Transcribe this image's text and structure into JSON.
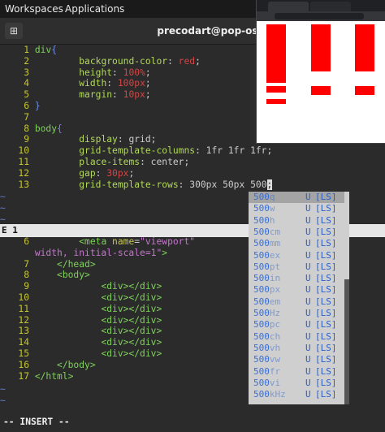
{
  "topbar": {
    "workspaces": "Workspaces",
    "applications": "Applications"
  },
  "window": {
    "title": "precodart@pop-os: ~"
  },
  "editor": {
    "css_lines": [
      {
        "n": "1",
        "parts": [
          [
            "kw",
            "div"
          ],
          [
            "br",
            "{"
          ]
        ]
      },
      {
        "n": "2",
        "parts": [
          [
            "t",
            "        "
          ],
          [
            "prop",
            "background-color"
          ],
          [
            "t",
            ": "
          ],
          [
            "val",
            "red"
          ],
          [
            "t",
            ";"
          ]
        ]
      },
      {
        "n": "3",
        "parts": [
          [
            "t",
            "        "
          ],
          [
            "prop",
            "height"
          ],
          [
            "t",
            ": "
          ],
          [
            "val",
            "100%"
          ],
          [
            "t",
            ";"
          ]
        ]
      },
      {
        "n": "4",
        "parts": [
          [
            "t",
            "        "
          ],
          [
            "prop",
            "width"
          ],
          [
            "t",
            ": "
          ],
          [
            "val",
            "100px"
          ],
          [
            "t",
            ";"
          ]
        ]
      },
      {
        "n": "5",
        "parts": [
          [
            "t",
            "        "
          ],
          [
            "prop",
            "margin"
          ],
          [
            "t",
            ": "
          ],
          [
            "val",
            "10px"
          ],
          [
            "t",
            ";"
          ]
        ]
      },
      {
        "n": "6",
        "parts": [
          [
            "br",
            "}"
          ]
        ]
      },
      {
        "n": "7",
        "parts": []
      },
      {
        "n": "8",
        "parts": [
          [
            "kw",
            "body"
          ],
          [
            "br",
            "{"
          ]
        ]
      },
      {
        "n": "9",
        "parts": [
          [
            "t",
            "        "
          ],
          [
            "prop",
            "display"
          ],
          [
            "t",
            ": "
          ],
          [
            "t",
            "grid"
          ],
          [
            "t",
            ";"
          ]
        ]
      },
      {
        "n": "10",
        "parts": [
          [
            "t",
            "        "
          ],
          [
            "prop",
            "grid-template-columns"
          ],
          [
            "t",
            ": 1fr 1fr 1fr;"
          ]
        ]
      },
      {
        "n": "11",
        "parts": [
          [
            "t",
            "        "
          ],
          [
            "prop",
            "place-items"
          ],
          [
            "t",
            ": "
          ],
          [
            "t",
            "center"
          ],
          [
            "t",
            ";"
          ]
        ]
      },
      {
        "n": "12",
        "parts": [
          [
            "t",
            "        "
          ],
          [
            "prop",
            "gap"
          ],
          [
            "t",
            ": "
          ],
          [
            "val",
            "30px"
          ],
          [
            "t",
            ";"
          ]
        ]
      },
      {
        "n": "13",
        "parts": [
          [
            "t",
            "        "
          ],
          [
            "prop",
            "grid-template-rows"
          ],
          [
            "t",
            ": 300px 50px 500"
          ],
          [
            "cursor",
            ";"
          ]
        ]
      }
    ],
    "tildes_top": [
      "~",
      "~",
      "~"
    ],
    "status_line": "E 1",
    "html_lines": [
      {
        "n": "6",
        "parts": [
          [
            "t",
            "        "
          ],
          [
            "tag",
            "<meta "
          ],
          [
            "attr",
            "name"
          ],
          [
            "t",
            "="
          ],
          [
            "str",
            "\"viewport\""
          ],
          [
            "t",
            "          "
          ],
          [
            "str",
            "ice-"
          ]
        ]
      },
      {
        "n": "",
        "parts": [
          [
            "str",
            "width, initial-scale=1\""
          ],
          [
            "tag",
            ">"
          ]
        ]
      },
      {
        "n": "7",
        "parts": [
          [
            "t",
            "    "
          ],
          [
            "tag",
            "</head>"
          ]
        ]
      },
      {
        "n": "8",
        "parts": [
          [
            "t",
            "    "
          ],
          [
            "tag",
            "<body>"
          ]
        ]
      },
      {
        "n": "9",
        "parts": [
          [
            "t",
            "            "
          ],
          [
            "tag",
            "<div></div>"
          ]
        ]
      },
      {
        "n": "10",
        "parts": [
          [
            "t",
            "            "
          ],
          [
            "tag",
            "<div></div>"
          ]
        ]
      },
      {
        "n": "11",
        "parts": [
          [
            "t",
            "            "
          ],
          [
            "tag",
            "<div></div>"
          ]
        ]
      },
      {
        "n": "12",
        "parts": [
          [
            "t",
            "            "
          ],
          [
            "tag",
            "<div></div>"
          ]
        ]
      },
      {
        "n": "13",
        "parts": [
          [
            "t",
            "            "
          ],
          [
            "tag",
            "<div></div>"
          ]
        ]
      },
      {
        "n": "14",
        "parts": [
          [
            "t",
            "            "
          ],
          [
            "tag",
            "<div></div>"
          ]
        ]
      },
      {
        "n": "15",
        "parts": [
          [
            "t",
            "            "
          ],
          [
            "tag",
            "<div></div>"
          ]
        ]
      },
      {
        "n": "16",
        "parts": [
          [
            "t",
            "    "
          ],
          [
            "tag",
            "</body>"
          ]
        ]
      },
      {
        "n": "17",
        "parts": [
          [
            "tag",
            "</html>"
          ]
        ]
      }
    ],
    "tildes_bottom": [
      "~",
      "~"
    ],
    "mode": "-- INSERT --"
  },
  "completion": {
    "items": [
      {
        "word": "500",
        "rest": "q",
        "kind": "U",
        "menu": "[LS]",
        "selected": true
      },
      {
        "word": "500",
        "rest": "w",
        "kind": "U",
        "menu": "[LS]"
      },
      {
        "word": "500",
        "rest": "h",
        "kind": "U",
        "menu": "[LS]"
      },
      {
        "word": "500",
        "rest": "cm",
        "kind": "U",
        "menu": "[LS]"
      },
      {
        "word": "500",
        "rest": "mm",
        "kind": "U",
        "menu": "[LS]"
      },
      {
        "word": "500",
        "rest": "ex",
        "kind": "U",
        "menu": "[LS]"
      },
      {
        "word": "500",
        "rest": "pt",
        "kind": "U",
        "menu": "[LS]"
      },
      {
        "word": "500",
        "rest": "in",
        "kind": "U",
        "menu": "[LS]"
      },
      {
        "word": "500",
        "rest": "px",
        "kind": "U",
        "menu": "[LS]"
      },
      {
        "word": "500",
        "rest": "em",
        "kind": "U",
        "menu": "[LS]"
      },
      {
        "word": "500",
        "rest": "Hz",
        "kind": "U",
        "menu": "[LS]"
      },
      {
        "word": "500",
        "rest": "pc",
        "kind": "U",
        "menu": "[LS]"
      },
      {
        "word": "500",
        "rest": "ch",
        "kind": "U",
        "menu": "[LS]"
      },
      {
        "word": "500",
        "rest": "vh",
        "kind": "U",
        "menu": "[LS]"
      },
      {
        "word": "500",
        "rest": "vw",
        "kind": "U",
        "menu": "[LS]"
      },
      {
        "word": "500",
        "rest": "fr",
        "kind": "U",
        "menu": "[LS]"
      },
      {
        "word": "500",
        "rest": "vi",
        "kind": "U",
        "menu": "[LS]"
      },
      {
        "word": "500",
        "rest": "kHz",
        "kind": "U",
        "menu": "[LS]"
      }
    ]
  },
  "colors": {
    "accent_red": "#ff0000",
    "terminal_bg": "#2b2b2b"
  }
}
